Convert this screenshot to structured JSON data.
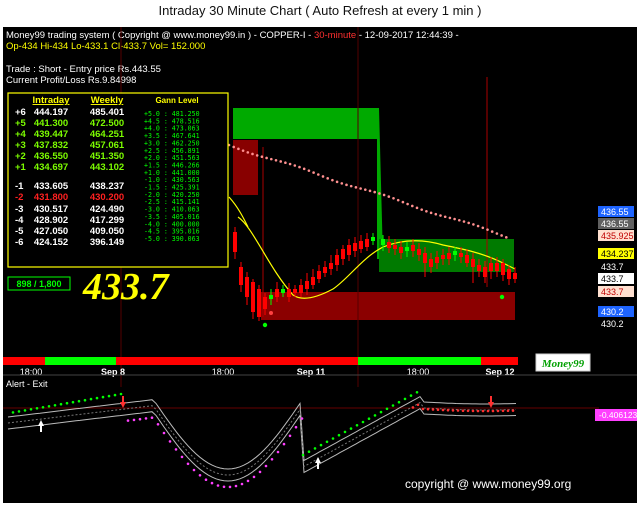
{
  "page_title": "Intraday 30 Minute Chart ( Auto Refresh at every 1 min )",
  "header": {
    "line1_prefix": "Money99 trading system ( Copyright @ www.money99.in ) - COPPER-I - ",
    "timeframe": "30-minute",
    "line1_suffix": " - 12-09-2017 12:44:39 -",
    "ohlc": "Op-434  Hi-434  Lo-433.1  Cl-433.7  Vol=  152.000",
    "trade": "Trade : Short - Entry price Rs.443.55",
    "pnl": "Current Profit/Loss Rs.9.84998"
  },
  "levels_table": {
    "header_intraday": "Intraday",
    "header_weekly": "Weekly",
    "header_gann": "Gann Level",
    "rows": [
      {
        "label": "+6",
        "intraday": "444.197",
        "weekly": "485.401",
        "color": "#ffffff"
      },
      {
        "label": "+5",
        "intraday": "441.300",
        "weekly": "472.500",
        "color": "#7CFC00"
      },
      {
        "label": "+4",
        "intraday": "439.447",
        "weekly": "464.251",
        "color": "#7CFC00"
      },
      {
        "label": "+3",
        "intraday": "437.832",
        "weekly": "457.061",
        "color": "#7CFC00"
      },
      {
        "label": "+2",
        "intraday": "436.550",
        "weekly": "451.350",
        "color": "#7CFC00"
      },
      {
        "label": "+1",
        "intraday": "434.697",
        "weekly": "443.102",
        "color": "#7CFC00"
      },
      {
        "label": "-1",
        "intraday": "433.605",
        "weekly": "438.237",
        "color": "#ffffff"
      },
      {
        "label": "-2",
        "intraday": "431.800",
        "weekly": "430.200",
        "color": "#ff2020"
      },
      {
        "label": "-3",
        "intraday": "430.517",
        "weekly": "424.490",
        "color": "#ffffff"
      },
      {
        "label": "-4",
        "intraday": "428.902",
        "weekly": "417.299",
        "color": "#ffffff"
      },
      {
        "label": "-5",
        "intraday": "427.050",
        "weekly": "409.050",
        "color": "#ffffff"
      },
      {
        "label": "-6",
        "intraday": "424.152",
        "weekly": "396.149",
        "color": "#ffffff"
      }
    ],
    "gann": [
      "+5.0  : 481.250",
      "+4.5  : 478.516",
      "+4.0  : 473.063",
      "+3.5  : 467.641",
      "+3.0  : 462.250",
      "+2.5  : 456.891",
      "+2.0  : 451.563",
      "+1.5  : 446.266",
      "+1.0  : 441.000",
      "-1.0  : 430.563",
      "-1.5  : 425.391",
      "-2.0  : 420.250",
      "-2.5  : 415.141",
      "-3.0  : 410.063",
      "-3.5  : 405.016",
      "-4.0  : 400.000",
      "-4.5  : 395.016",
      "-5.0  : 390.063"
    ]
  },
  "ratio_box": "898 / 1,800",
  "current_price": "433.7",
  "price_tags": [
    {
      "text": "436.55",
      "bg": "#1e64ff",
      "fg": "#ffffff"
    },
    {
      "text": "436.55",
      "bg": "#606060",
      "fg": "#ffffff"
    },
    {
      "text": "435.925",
      "bg": "#ffe0d0",
      "fg": "#c00000"
    },
    {
      "text": "434.237",
      "bg": "#ffff00",
      "fg": "#000000"
    },
    {
      "text": "433.7",
      "bg": "#000000",
      "fg": "#ffffff"
    },
    {
      "text": "433.7",
      "bg": "#ffffff",
      "fg": "#000000"
    },
    {
      "text": "433.7",
      "bg": "#ffe0d0",
      "fg": "#c00000"
    },
    {
      "text": "430.2",
      "bg": "#1e64ff",
      "fg": "#ffffff"
    },
    {
      "text": "430.2",
      "bg": "#000000",
      "fg": "#ffffff"
    }
  ],
  "time_axis": [
    "18:00",
    "Sep 8",
    "18:00",
    "Sep 11",
    "18:00",
    "Sep 12"
  ],
  "logo": "Money99",
  "indicator_title": "Alert - Exit",
  "indicator_value": "-0.406123",
  "watermark": "copyright @ www.money99.org",
  "colors": {
    "bull": "#00ff00",
    "bear": "#ff0000",
    "accent_red": "#ff3030",
    "ema": "#ffff00",
    "sar": "#ff9090"
  }
}
